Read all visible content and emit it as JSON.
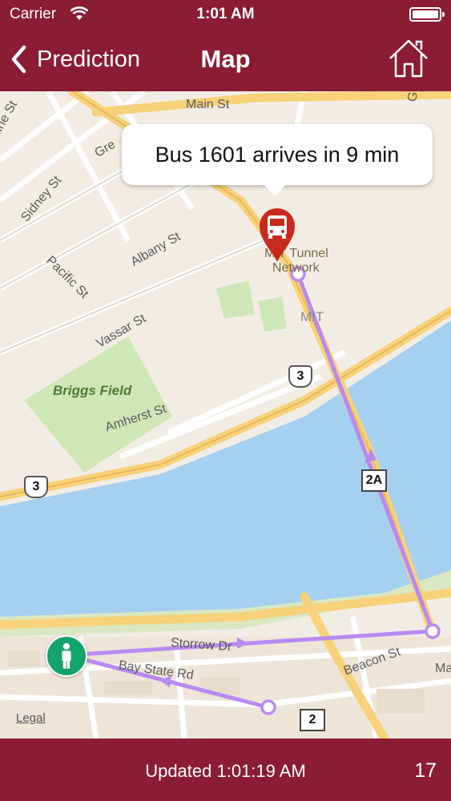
{
  "status_bar": {
    "carrier": "Carrier",
    "time": "1:01 AM"
  },
  "nav": {
    "back_label": "Prediction",
    "title": "Map"
  },
  "map": {
    "callout": "Bus 1601 arrives in 9 min",
    "legal": "Legal",
    "labels": {
      "main_st": "Main St",
      "kline_st": "kline St",
      "sidney_st": "Sidney St",
      "pacific_st": "Pacific St",
      "albany_st": "Albany St",
      "vassar_st": "Vassar St",
      "briggs_field": "Briggs Field",
      "amherst_st": "Amherst St",
      "mit_tunnel_1": "MIT Tunnel",
      "mit_tunnel_2": "Network",
      "mit": "MIT",
      "storrow_dr": "Storrow Dr",
      "bay_state_rd": "Bay State Rd",
      "beacon_st": "Beacon St",
      "gr": "Gre",
      "g": "G",
      "ma": "Ma"
    },
    "shields": {
      "route3_a": "3",
      "route3_b": "3",
      "route2a": "2A",
      "route2": "2"
    }
  },
  "toolbar": {
    "updated": "Updated  1:01:19 AM",
    "count": "17"
  },
  "colors": {
    "brand": "#8a1c34",
    "route": "#b98af0",
    "water": "#a6d0ef",
    "park": "#cfe6b6"
  }
}
